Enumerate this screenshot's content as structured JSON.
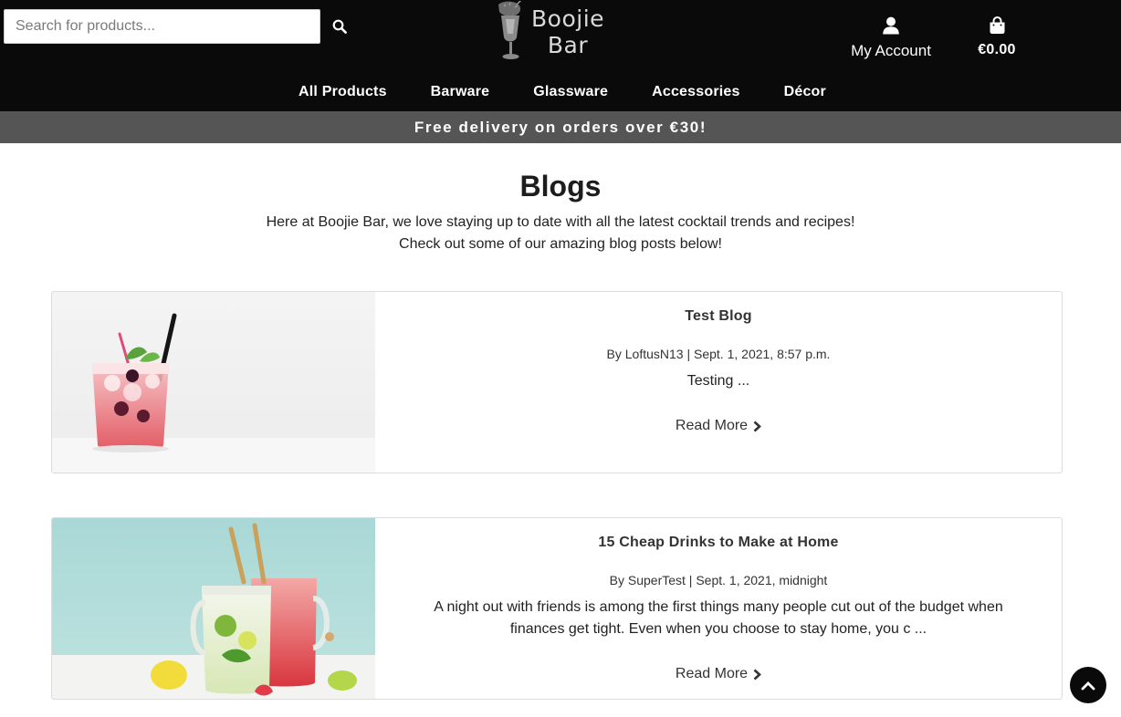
{
  "header": {
    "search": {
      "placeholder": "Search for products...",
      "value": ""
    },
    "logo": {
      "line1": "Boojie",
      "line2": "Bar"
    },
    "account_label": "My Account",
    "cart_total": "€0.00"
  },
  "nav": {
    "items": [
      {
        "label": "All Products"
      },
      {
        "label": "Barware"
      },
      {
        "label": "Glassware"
      },
      {
        "label": "Accessories"
      },
      {
        "label": "Décor"
      }
    ]
  },
  "banner": {
    "text": "Free delivery on orders over €30!"
  },
  "main": {
    "title": "Blogs",
    "intro_line1": "Here at Boojie Bar, we love staying up to date with all the latest cocktail trends and recipes!",
    "intro_line2": "Check out some of our amazing blog posts below!",
    "posts": [
      {
        "title": "Test Blog",
        "meta": "By LoftusN13 | Sept. 1, 2021, 8:57 p.m.",
        "excerpt": "Testing ...",
        "read_more": "Read More"
      },
      {
        "title": "15 Cheap Drinks to Make at Home",
        "meta": "By SuperTest | Sept. 1, 2021, midnight",
        "excerpt": "A night out with friends is among the first things many people cut out of the budget when finances get tight. Even when you choose to stay home, you c ...",
        "read_more": "Read More"
      }
    ]
  },
  "icons": {
    "search": "search-icon",
    "account": "user-icon",
    "cart": "shopping-bag-icon",
    "read_more": "chevron-right-icon",
    "back_to_top": "chevron-up-icon"
  },
  "colors": {
    "header_bg": "#0a0a0a",
    "banner_bg": "#555555",
    "text": "#222222",
    "card_border": "#dcdcdc"
  }
}
